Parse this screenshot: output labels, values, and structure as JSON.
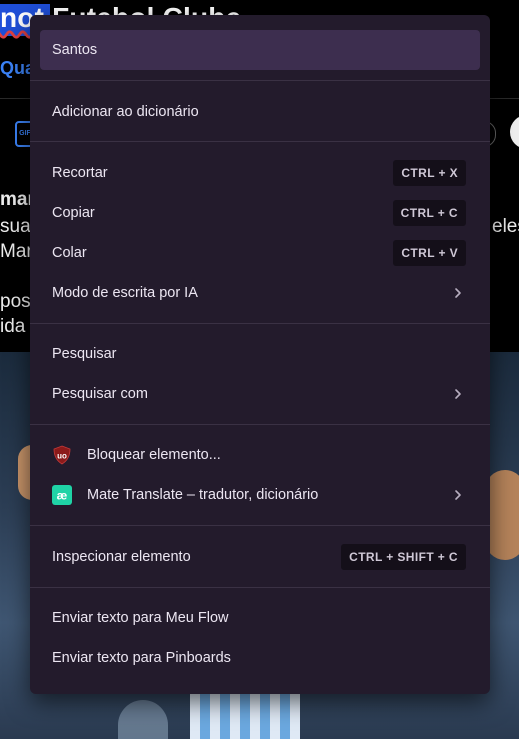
{
  "background": {
    "title_selected": "not",
    "title_rest": " Futebol Clube",
    "link_text": "Qua",
    "text_lines": [
      "man",
      "sua c",
      "Mar",
      "post",
      "ida"
    ],
    "text_right": "eles"
  },
  "menu": {
    "highlight_item": "Santos",
    "add_dictionary": "Adicionar ao dicionário",
    "cut": {
      "label": "Recortar",
      "shortcut": "CTRL + X"
    },
    "copy": {
      "label": "Copiar",
      "shortcut": "CTRL + C"
    },
    "paste": {
      "label": "Colar",
      "shortcut": "CTRL + V"
    },
    "ai_writing": "Modo de escrita por IA",
    "search": "Pesquisar",
    "search_with": "Pesquisar com",
    "block_element": "Bloquear elemento...",
    "mate_translate": "Mate Translate – tradutor, dicionário",
    "inspect": {
      "label": "Inspecionar elemento",
      "shortcut": "CTRL + SHIFT + C"
    },
    "send_flow": "Enviar texto para Meu Flow",
    "send_pinboards": "Enviar texto para Pinboards"
  },
  "colors": {
    "menu_bg": "#231b2c",
    "highlight_bg": "#3d2e4f",
    "ublock_red": "#8b1a1a",
    "mate_teal": "#1fd3a6"
  }
}
